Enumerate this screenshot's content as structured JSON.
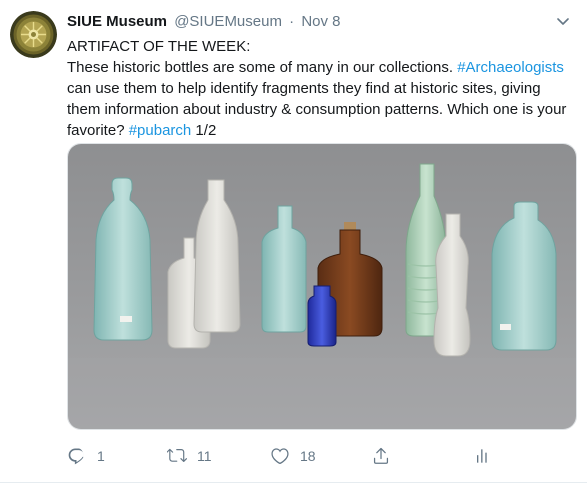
{
  "tweet": {
    "name": "SIUE Museum",
    "handle": "@SIUEMuseum",
    "separator": "·",
    "date": "Nov 8",
    "text": {
      "line1": "ARTIFACT OF THE WEEK:",
      "line2_text": "These historic bottles are some of many in our collections. ",
      "line2_hashtag": "#Archaeologists",
      "line3": "can use them to help identify fragments they find at historic sites, giving",
      "line4": "them information about industry & consumption patterns. Which one is your",
      "line5_text": "favorite? ",
      "line5_hashtag": "#pubarch",
      "line5_suffix": " 1/2"
    },
    "media_description_icon": "photo-of-historic-bottles",
    "actions": {
      "reply_count": "1",
      "retweet_count": "11",
      "like_count": "18"
    }
  },
  "icons": {
    "avatar": "museum-logo-icon",
    "caret": "chevron-down-icon",
    "reply": "reply-icon",
    "retweet": "retweet-icon",
    "like": "heart-icon",
    "share": "share-icon",
    "analytics": "analytics-icon"
  },
  "colors": {
    "text": "#14171a",
    "secondary": "#657786",
    "link": "#1b95e0"
  }
}
